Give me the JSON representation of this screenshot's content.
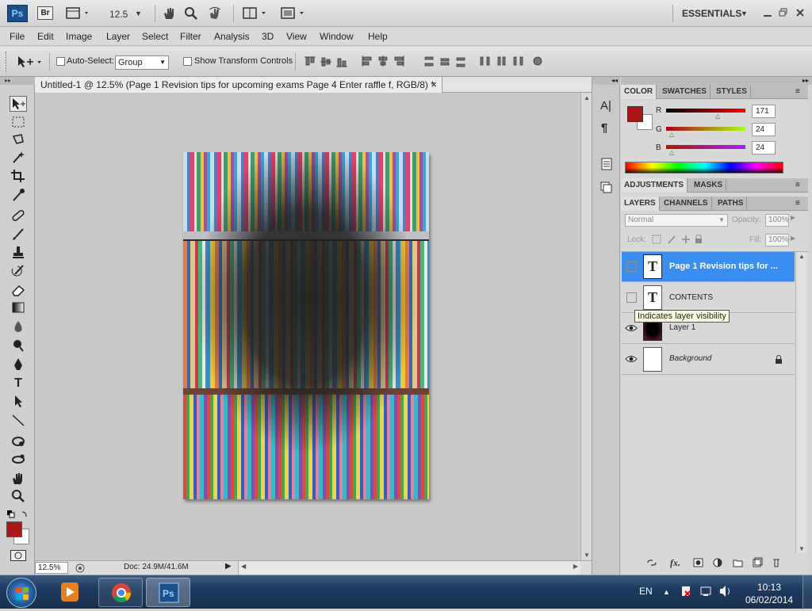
{
  "app": {
    "logo": "Ps",
    "bridge": "Br",
    "zoom_value": "12.5",
    "workspace": "ESSENTIALS"
  },
  "menu": [
    "File",
    "Edit",
    "Image",
    "Layer",
    "Select",
    "Filter",
    "Analysis",
    "3D",
    "View",
    "Window",
    "Help"
  ],
  "options": {
    "auto_select_label": "Auto-Select:",
    "auto_select_value": "Group",
    "transform_label": "Show Transform Controls"
  },
  "document": {
    "tab_title": "Untitled-1 @ 12.5% (Page 1 Revision tips for upcoming  exams  Page 4 Enter raffle f, RGB/8) *",
    "close": "×"
  },
  "status": {
    "zoom": "12.5%",
    "doc_info": "Doc: 24.9M/41.6M"
  },
  "color_panel": {
    "tabs": [
      "COLOR",
      "SWATCHES",
      "STYLES"
    ],
    "foreground": "#ab1818",
    "r_label": "R",
    "r_value": "171",
    "g_label": "G",
    "g_value": "24",
    "b_label": "B",
    "b_value": "24"
  },
  "adjust_panel": {
    "tabs": [
      "ADJUSTMENTS",
      "MASKS"
    ]
  },
  "layers_panel": {
    "tabs": [
      "LAYERS",
      "CHANNELS",
      "PATHS"
    ],
    "blend_mode": "Normal",
    "opacity_label": "Opacity:",
    "opacity_value": "100%",
    "lock_label": "Lock:",
    "fill_label": "Fill:",
    "fill_value": "100%",
    "tooltip": "Indicates layer visibility",
    "layers": [
      {
        "name": "Page 1 Revision tips for ...",
        "type": "text",
        "selected": true,
        "visible": false
      },
      {
        "name": "CONTENTS",
        "type": "text",
        "selected": false,
        "visible": false
      },
      {
        "name": "Layer 1",
        "type": "image",
        "selected": false,
        "visible": true
      },
      {
        "name": "Background",
        "type": "background",
        "selected": false,
        "visible": true
      }
    ]
  },
  "taskbar": {
    "lang": "EN",
    "time": "10:13",
    "date": "06/02/2014"
  }
}
